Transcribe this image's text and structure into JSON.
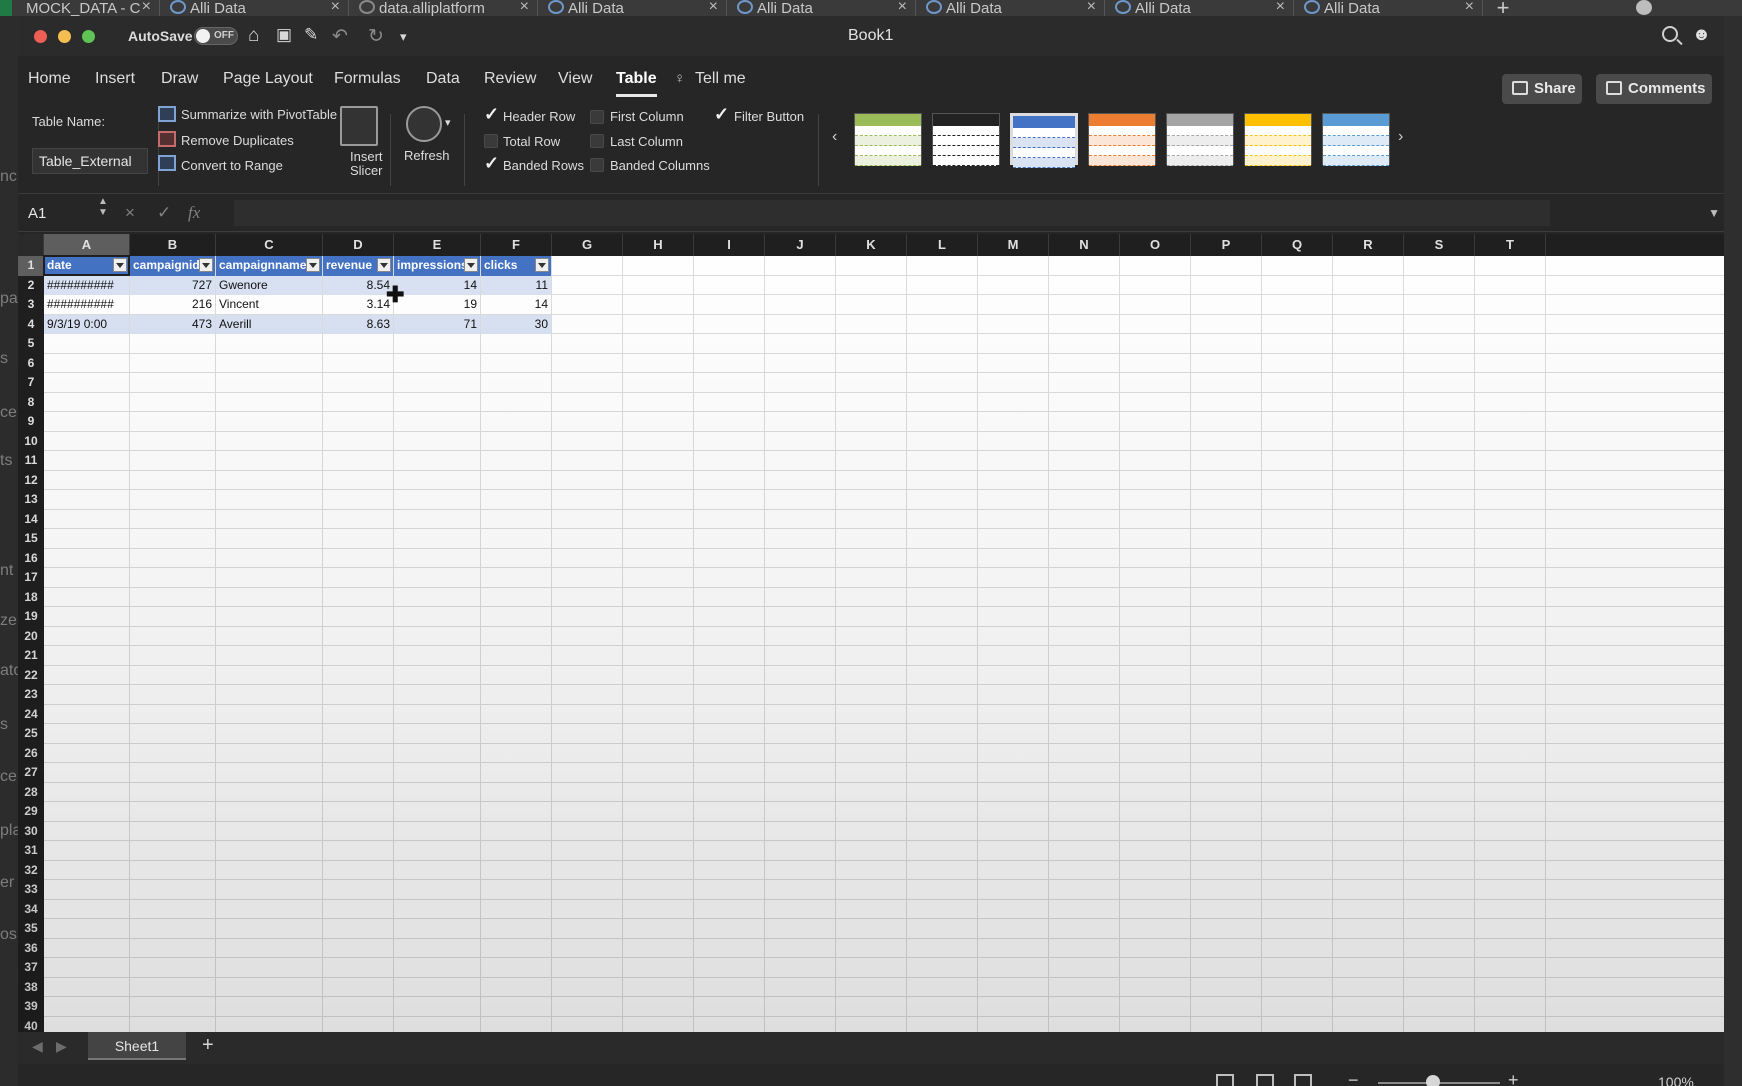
{
  "browser_tabs": [
    {
      "label": "MOCK_DATA - C"
    },
    {
      "label": "Alli Data"
    },
    {
      "label": "data.alliplatform"
    },
    {
      "label": "Alli Data"
    },
    {
      "label": "Alli Data"
    },
    {
      "label": "Alli Data"
    },
    {
      "label": "Alli Data"
    },
    {
      "label": "Alli Data"
    }
  ],
  "left_strip_fragments": [
    "nc",
    "par",
    "s",
    "ce",
    "ts",
    "nt",
    "ze",
    "ato",
    "s",
    "ce",
    "pla",
    "er",
    "os"
  ],
  "window": {
    "title": "Book1",
    "autosave_label": "AutoSave",
    "autosave_state": "OFF"
  },
  "ribbon_tabs": [
    "Home",
    "Insert",
    "Draw",
    "Page Layout",
    "Formulas",
    "Data",
    "Review",
    "View",
    "Table",
    "Tell me"
  ],
  "active_tab": "Table",
  "share_label": "Share",
  "comments_label": "Comments",
  "table_group": {
    "table_name_label": "Table Name:",
    "table_name_value": "Table_External",
    "summarize": "Summarize with PivotTable",
    "remove_dupes": "Remove Duplicates",
    "convert": "Convert to Range",
    "insert_slicer_1": "Insert",
    "insert_slicer_2": "Slicer",
    "refresh": "Refresh"
  },
  "style_options": {
    "header_row": {
      "label": "Header Row",
      "checked": true
    },
    "total_row": {
      "label": "Total Row",
      "checked": false
    },
    "banded_rows": {
      "label": "Banded Rows",
      "checked": true
    },
    "first_column": {
      "label": "First Column",
      "checked": false
    },
    "last_column": {
      "label": "Last Column",
      "checked": false
    },
    "banded_columns": {
      "label": "Banded Columns",
      "checked": false
    },
    "filter_button": {
      "label": "Filter Button",
      "checked": true
    }
  },
  "table_styles": [
    {
      "line": "#9bbb59",
      "fill": "#ebf1de"
    },
    {
      "line": "#222222",
      "fill": "#ffffff"
    },
    {
      "line": "#4472c4",
      "fill": "#dae3f3"
    },
    {
      "line": "#ed7d31",
      "fill": "#fbe5d6"
    },
    {
      "line": "#a5a5a5",
      "fill": "#ededed"
    },
    {
      "line": "#ffc000",
      "fill": "#fff2cc"
    },
    {
      "line": "#5b9bd5",
      "fill": "#deebf7"
    }
  ],
  "formula_bar": {
    "name_box": "A1",
    "fx": "fx",
    "formula": ""
  },
  "columns": [
    "A",
    "B",
    "C",
    "D",
    "E",
    "F",
    "G",
    "H",
    "I",
    "J",
    "K",
    "L",
    "M",
    "N",
    "O",
    "P",
    "Q",
    "R",
    "S",
    "T"
  ],
  "rows": [
    "1",
    "2",
    "3",
    "4",
    "5",
    "6",
    "7",
    "8",
    "9",
    "10",
    "11",
    "12",
    "13",
    "14",
    "15",
    "16",
    "17",
    "18",
    "19",
    "20",
    "21",
    "22",
    "23",
    "24",
    "25",
    "26",
    "27",
    "28",
    "29",
    "30",
    "31",
    "32",
    "33",
    "34",
    "35",
    "36",
    "37",
    "38",
    "39",
    "40"
  ],
  "table": {
    "headers": [
      "date",
      "campaignid",
      "campaignname",
      "revenue",
      "impressions",
      "clicks"
    ],
    "rows": [
      [
        "##########",
        "727",
        "Gwenore",
        "8.54",
        "14",
        "11"
      ],
      [
        "##########",
        "216",
        "Vincent",
        "3.14",
        "19",
        "14"
      ],
      [
        "9/3/19 0:00",
        "473",
        "Averill",
        "8.63",
        "71",
        "30"
      ]
    ]
  },
  "sheet_tab": "Sheet1",
  "add_sheet": "+",
  "zoom": "100%"
}
